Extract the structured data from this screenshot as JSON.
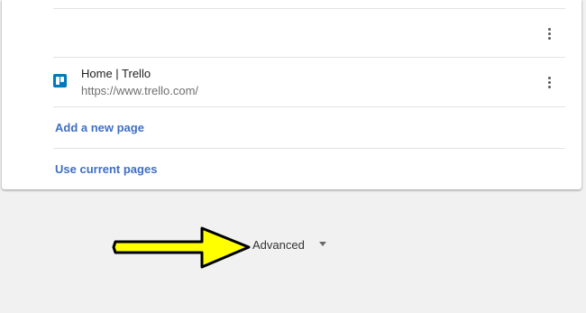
{
  "startup_pages": {
    "items": [
      {
        "title": "",
        "url": ""
      },
      {
        "title": "Home | Trello",
        "url": "https://www.trello.com/"
      }
    ],
    "add_page_label": "Add a new page",
    "use_current_label": "Use current pages"
  },
  "advanced": {
    "label": "Advanced"
  },
  "annotation": {
    "arrow_color": "#ffff00",
    "arrow_outline_color": "#000000"
  },
  "colors": {
    "link": "#3f6fc4",
    "trello_brand": "#0079bf",
    "page_background": "#f1f1f1"
  }
}
